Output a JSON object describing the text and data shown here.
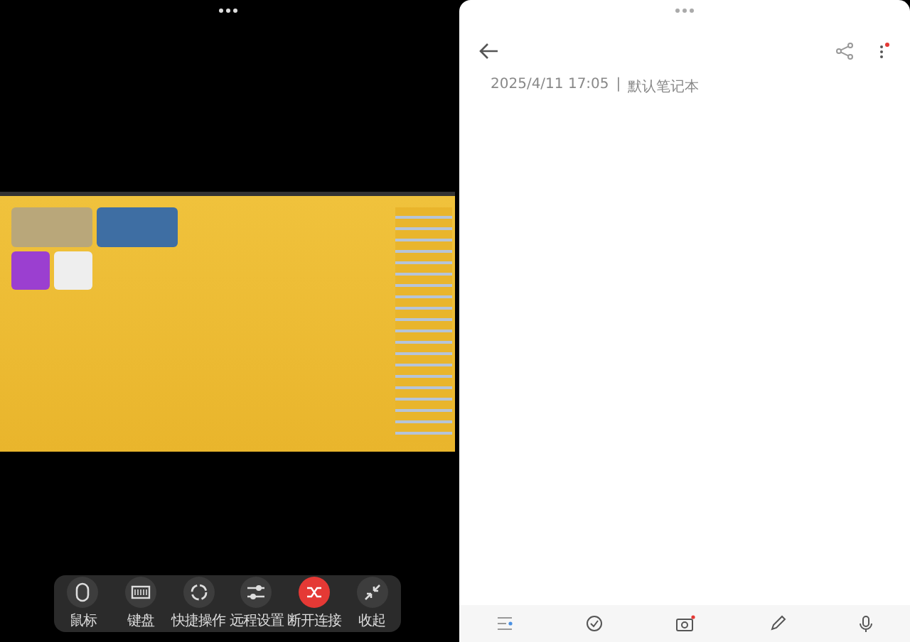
{
  "remote_controls": [
    {
      "kind": "mouse",
      "label": "鼠标"
    },
    {
      "kind": "keyboard",
      "label": "键盘"
    },
    {
      "kind": "quick",
      "label": "快捷操作"
    },
    {
      "kind": "settings",
      "label": "远程设置"
    },
    {
      "kind": "disconnect",
      "label": "断开连接"
    },
    {
      "kind": "collapse",
      "label": "收起"
    }
  ],
  "note": {
    "date": "2025/4/11 17:05",
    "separator": "|",
    "notebook": "默认笔记本"
  }
}
